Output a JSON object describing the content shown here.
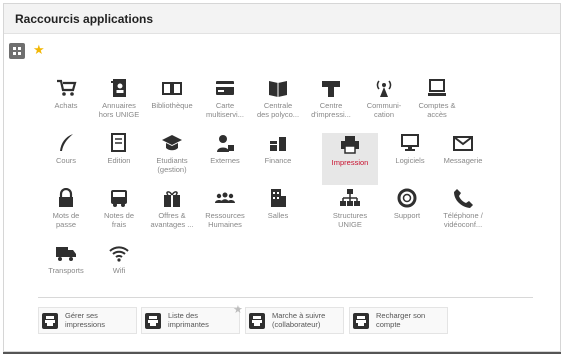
{
  "panel": {
    "title": "Raccourcis applications"
  },
  "colors": {
    "accent": "#c8102e",
    "star": "#f2b705",
    "icon": "#2f2f2f"
  },
  "apps": [
    {
      "label": "Achats",
      "icon": "cart-icon"
    },
    {
      "label": "Annuaires\nhors UNIGE",
      "icon": "address-book-icon"
    },
    {
      "label": "Bibliothèque",
      "icon": "book-icon"
    },
    {
      "label": "Carte\nmultiservi...",
      "icon": "card-icon"
    },
    {
      "label": "Centrale\ndes polyco...",
      "icon": "open-book-icon"
    },
    {
      "label": "Centre\nd'impressi...",
      "icon": "print-center-icon"
    },
    {
      "label": "Communi-\ncation",
      "icon": "antenna-icon"
    },
    {
      "label": "Comptes &\naccès",
      "icon": "computer-icon"
    },
    {
      "label": "Cours",
      "icon": "quill-icon"
    },
    {
      "label": "Edition",
      "icon": "edit-document-icon"
    },
    {
      "label": "Etudiants\n(gestion)",
      "icon": "graduation-cap-icon"
    },
    {
      "label": "Externes",
      "icon": "person-badge-icon"
    },
    {
      "label": "Finance",
      "icon": "coins-icon"
    },
    {
      "label": "Impression",
      "icon": "printer-icon",
      "selected": true
    },
    {
      "label": "Logiciels",
      "icon": "monitor-icon"
    },
    {
      "label": "Messagerie",
      "icon": "envelope-icon"
    },
    {
      "label": "Mots de\npasse",
      "icon": "lock-icon"
    },
    {
      "label": "Notes de\nfrais",
      "icon": "bus-icon"
    },
    {
      "label": "Offres &\navantages ...",
      "icon": "gift-icon"
    },
    {
      "label": "Ressources\nHumaines",
      "icon": "people-icon"
    },
    {
      "label": "Salles",
      "icon": "building-icon"
    },
    {
      "label": "Structures\nUNIGE",
      "icon": "hierarchy-icon"
    },
    {
      "label": "Support",
      "icon": "lifebuoy-icon"
    },
    {
      "label": "Téléphone /\nvidéoconf...",
      "icon": "phone-icon"
    },
    {
      "label": "Transports",
      "icon": "truck-icon"
    },
    {
      "label": "Wifi",
      "icon": "wifi-icon"
    }
  ],
  "shortcuts": [
    {
      "label": "Gérer ses\nimpressions",
      "icon": "printer-icon"
    },
    {
      "label": "Liste des\nimprimantes",
      "icon": "printer-icon"
    },
    {
      "label": "Marche à suivre\n(collaborateur)",
      "icon": "printer-icon"
    },
    {
      "label": "Recharger son\ncompte",
      "icon": "printer-icon"
    }
  ]
}
